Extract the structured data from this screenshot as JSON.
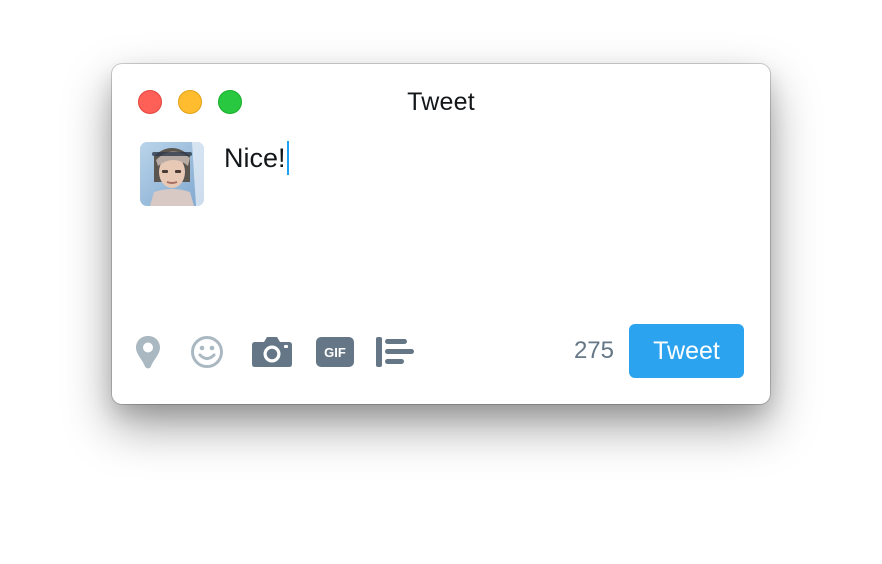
{
  "window": {
    "title": "Tweet",
    "controls": [
      "close",
      "minimize",
      "maximize"
    ]
  },
  "user": {
    "avatar": "profile-photo"
  },
  "compose": {
    "text": "Nice!"
  },
  "toolbar": {
    "icons": [
      "location-pin-icon",
      "emoji-icon",
      "camera-icon",
      "gif-icon",
      "poll-icon"
    ],
    "gif_label": "GIF",
    "remaining_chars": "275",
    "tweet_label": "Tweet"
  },
  "colors": {
    "accent": "#2ba3ef",
    "caret": "#1da1f2",
    "icon_light": "#aab8c2",
    "icon_dark": "#657786",
    "close": "#fe5f57",
    "minimize": "#febc2e",
    "maximize": "#28c840"
  }
}
